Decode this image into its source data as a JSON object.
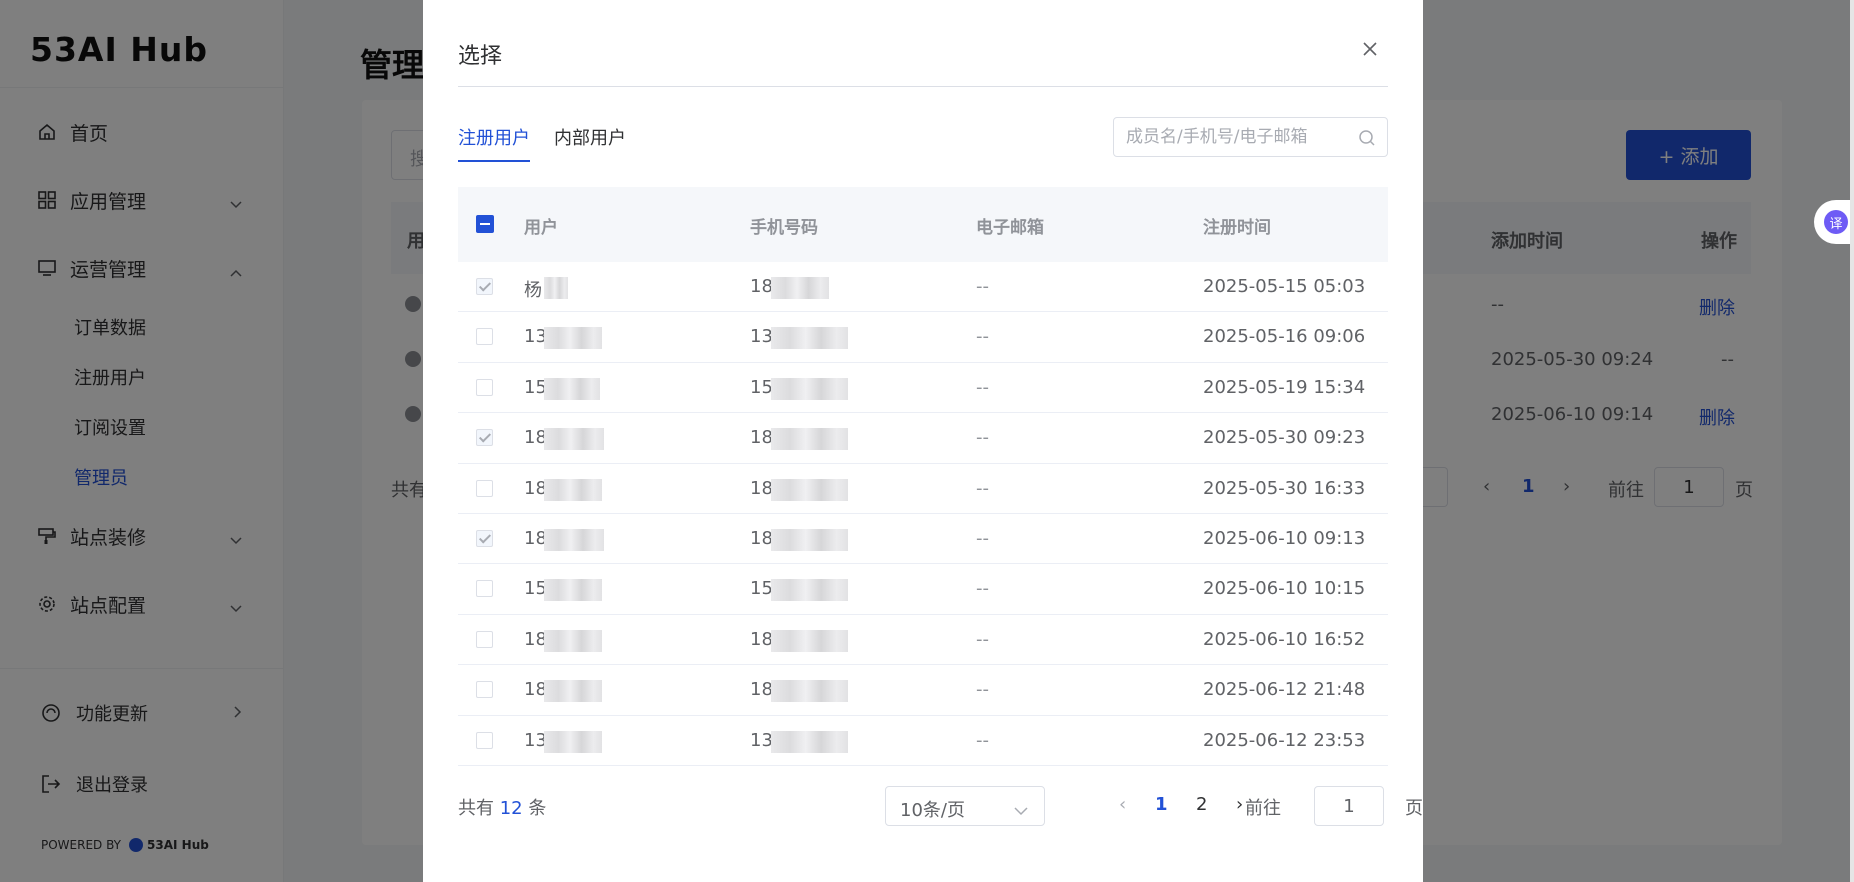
{
  "background": {
    "logo": "53AI Hub",
    "page_title": "管理",
    "nav": [
      {
        "label": "首页",
        "icon": "home-icon"
      },
      {
        "label": "应用管理",
        "icon": "grid-icon"
      },
      {
        "label": "运营管理",
        "icon": "monitor-icon"
      },
      {
        "label": "站点装修",
        "icon": "brush-icon"
      },
      {
        "label": "站点配置",
        "icon": "gear-icon"
      }
    ],
    "sub_nav": [
      "订单数据",
      "注册用户",
      "订阅设置",
      "管理员"
    ],
    "footer": {
      "updates": "功能更新",
      "logout": "退出登录",
      "powered": "POWERED BY",
      "powered_brand": "53AI Hub"
    },
    "search_stub": "搜",
    "add_button": "+ 添加",
    "th_user": "用",
    "th_time": "添加时间",
    "th_action": "操作",
    "rows": [
      {
        "time": "--",
        "action": "删除"
      },
      {
        "time": "2025-05-30 09:24",
        "action": "--"
      },
      {
        "time": "2025-06-10 09:14",
        "action": "删除"
      }
    ],
    "total_stub": "共有",
    "pager": {
      "prev": "‹",
      "page": "1",
      "next": "›",
      "goto": "前往",
      "goto_value": "1",
      "suffix": "页"
    }
  },
  "dialog": {
    "title": "选择",
    "tabs": [
      "注册用户",
      "内部用户"
    ],
    "active_tab": 0,
    "search_placeholder": "成员名/手机号/电子邮箱",
    "columns": [
      "用户",
      "手机号码",
      "电子邮箱",
      "注册时间"
    ],
    "rows": [
      {
        "checked": true,
        "user": "杨",
        "phone": "18",
        "email": "--",
        "time": "2025-05-15 05:03"
      },
      {
        "checked": false,
        "user": "13",
        "phone": "13",
        "email": "--",
        "time": "2025-05-16 09:06"
      },
      {
        "checked": false,
        "user": "15",
        "phone": "15",
        "email": "--",
        "time": "2025-05-19 15:34"
      },
      {
        "checked": true,
        "user": "18",
        "phone": "18",
        "email": "--",
        "time": "2025-05-30 09:23"
      },
      {
        "checked": false,
        "user": "18",
        "phone": "18",
        "email": "--",
        "time": "2025-05-30 16:33"
      },
      {
        "checked": true,
        "user": "18",
        "phone": "18",
        "email": "--",
        "time": "2025-06-10 09:13"
      },
      {
        "checked": false,
        "user": "15",
        "phone": "15",
        "email": "--",
        "time": "2025-06-10 10:15"
      },
      {
        "checked": false,
        "user": "18",
        "phone": "18",
        "email": "--",
        "time": "2025-06-10 16:52"
      },
      {
        "checked": false,
        "user": "18",
        "phone": "18",
        "email": "--",
        "time": "2025-06-12 21:48"
      },
      {
        "checked": false,
        "user": "13",
        "phone": "13",
        "email": "--",
        "time": "2025-06-12 23:53"
      }
    ],
    "pagination": {
      "total_prefix": "共有",
      "total": "12",
      "total_suffix": "条",
      "page_size": "10条/页",
      "prev": "‹",
      "pages": [
        "1",
        "2"
      ],
      "current_page": "1",
      "next": "›",
      "goto": "前往",
      "goto_value": "1",
      "goto_suffix": "页"
    }
  },
  "translate_badge": "译",
  "colors": {
    "accent": "#2251d6",
    "overlay": "rgba(0,0,0,0.5)"
  }
}
